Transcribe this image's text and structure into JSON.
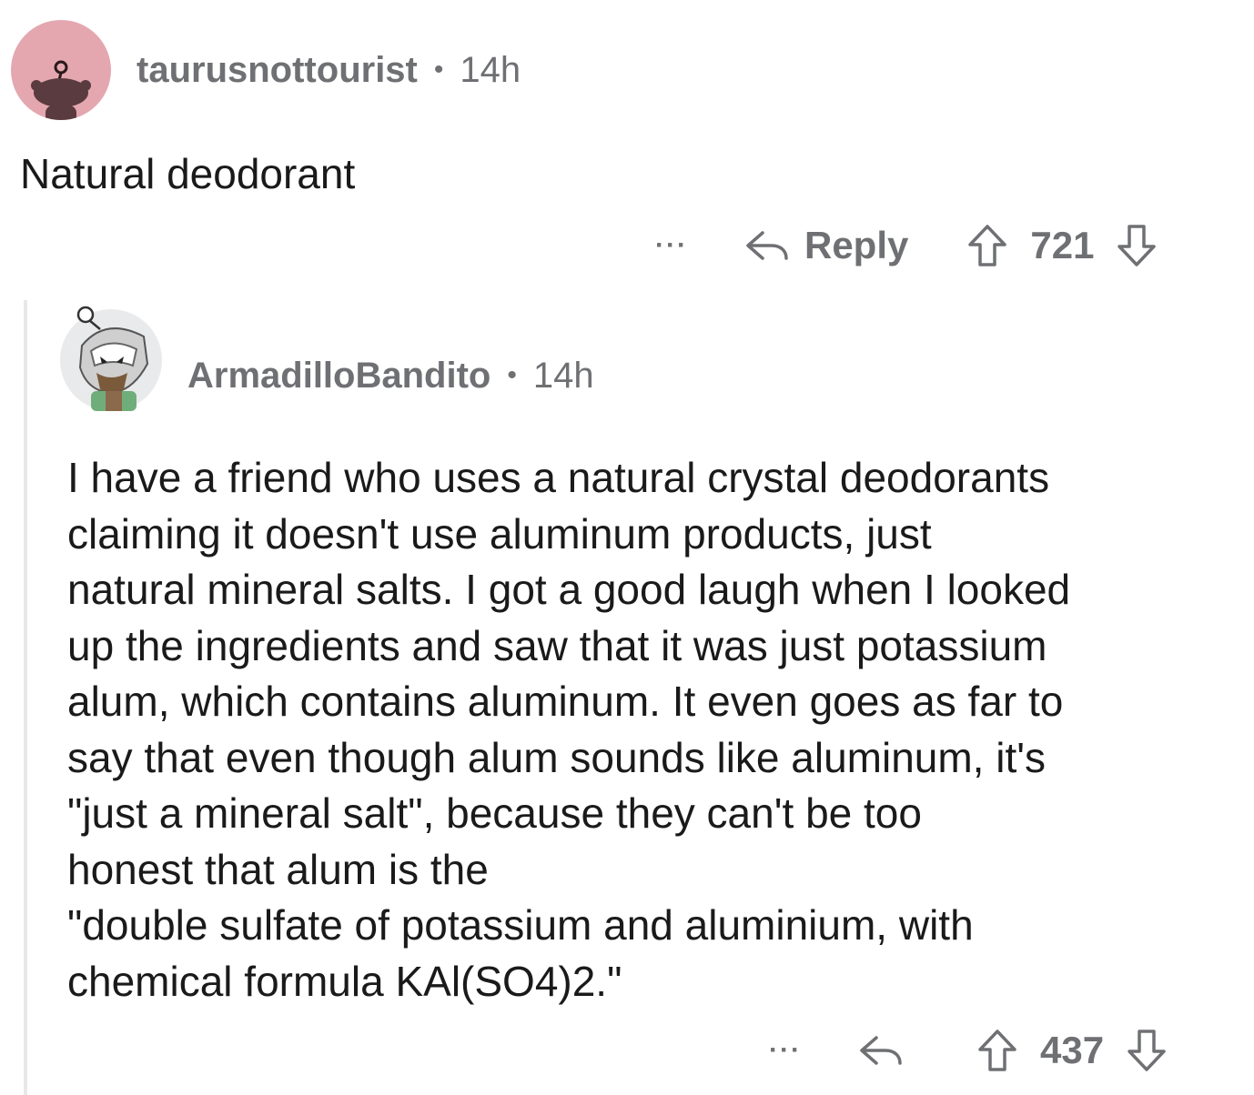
{
  "comment1": {
    "username": "taurusnottourist",
    "separator": "•",
    "time": "14h",
    "body": "Natural deodorant",
    "more": "···",
    "reply_label": "Reply",
    "score": "721"
  },
  "comment2": {
    "username": "ArmadilloBandito",
    "separator": "•",
    "time": "14h",
    "body_lines": [
      "I have a friend who uses a natural crystal deodorants",
      "claiming it doesn't use aluminum products, just",
      "natural mineral salts. I got a good laugh when I looked",
      "up the ingredients and saw that it was just potassium",
      "alum, which contains aluminum. It even goes as far to",
      "say that even though alum sounds like aluminum, it's",
      "\"just a mineral salt\", because they can't be too",
      "honest that alum is the",
      "\"double sulfate of potassium and aluminium, with",
      "chemical formula KAl(SO4)2.\""
    ],
    "more": "···",
    "score": "437"
  },
  "colors": {
    "meta_gray": "#6f7073",
    "text": "#1a1a1b",
    "avatar1_bg": "#e4a7b0",
    "thread_line": "#e7e8ea"
  },
  "icons": {
    "reply": "reply-arrow-icon",
    "upvote": "upvote-arrow-icon",
    "downvote": "downvote-arrow-icon"
  }
}
